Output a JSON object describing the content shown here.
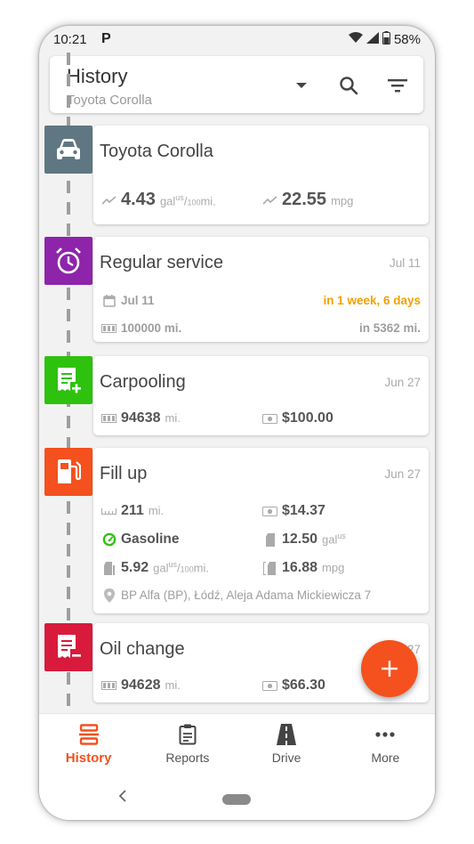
{
  "status": {
    "time": "10:21",
    "app_letter": "P",
    "battery": "58%"
  },
  "header": {
    "title": "History",
    "subtitle": "Toyota Corolla"
  },
  "colors": {
    "accent": "#f4511e",
    "vehicle": "#5f7782",
    "reminder": "#8e24aa",
    "income": "#2ec20f",
    "refuel": "#f4511e",
    "expense": "#d81b3c",
    "warning": "#f0a000"
  },
  "entries": {
    "vehicle": {
      "title": "Toyota Corolla",
      "consumption_value": "4.43",
      "consumption_unit_a": "gal",
      "consumption_unit_sup": "us",
      "consumption_unit_b": "/",
      "consumption_unit_sub": "100",
      "consumption_unit_c": "mi.",
      "economy_value": "22.55",
      "economy_unit": "mpg",
      "icon": "car-icon"
    },
    "service": {
      "title": "Regular service",
      "date": "Jul 11",
      "due_date": "Jul 11",
      "due_in": "in 1 week, 6 days",
      "odometer": "100000 mi.",
      "odometer_in": "in 5362 mi.",
      "icon": "alarm-clock-icon"
    },
    "carpooling": {
      "title": "Carpooling",
      "date": "Jun 27",
      "odometer_value": "94638",
      "odometer_unit": "mi.",
      "amount": "$100.00",
      "icon": "receipt-add-icon"
    },
    "fillup": {
      "title": "Fill up",
      "date": "Jun 27",
      "distance_value": "211",
      "distance_unit": "mi.",
      "cost": "$14.37",
      "fuel_type": "Gasoline",
      "volume_value": "12.50",
      "volume_unit": "gal",
      "volume_sup": "us",
      "consumption_value": "5.92",
      "consumption_unit_a": "gal",
      "consumption_sup": "us",
      "consumption_unit_b": "/",
      "consumption_sub": "100",
      "consumption_unit_c": "mi.",
      "economy_value": "16.88",
      "economy_unit": "mpg",
      "location": "BP Alfa (BP), Łódź, Aleja Adama Mickiewicza 7",
      "icon": "fuel-pump-icon"
    },
    "oilchange": {
      "title": "Oil change",
      "date": "Jun 27",
      "odometer_value": "94628",
      "odometer_unit": "mi.",
      "amount": "$66.30",
      "icon": "receipt-remove-icon"
    }
  },
  "fab": {
    "label": "+"
  },
  "nav": {
    "items": [
      {
        "label": "History",
        "icon": "history-icon",
        "active": true
      },
      {
        "label": "Reports",
        "icon": "clipboard-icon",
        "active": false
      },
      {
        "label": "Drive",
        "icon": "road-icon",
        "active": false
      },
      {
        "label": "More",
        "icon": "more-dots-icon",
        "active": false
      }
    ]
  }
}
